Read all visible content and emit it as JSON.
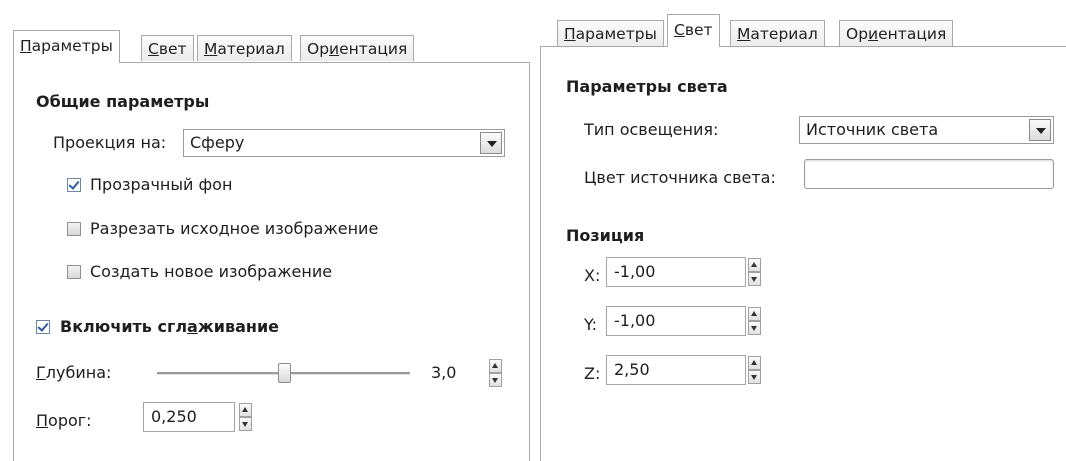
{
  "left": {
    "tabs": [
      {
        "pre": "",
        "acc": "П",
        "post": "араметры",
        "active": true
      },
      {
        "pre": "",
        "acc": "С",
        "post": "вет",
        "active": false
      },
      {
        "pre": "",
        "acc": "М",
        "post": "атериал",
        "active": false
      },
      {
        "pre": "Ор",
        "acc": "и",
        "post": "ентация",
        "active": false
      }
    ],
    "general_title": "Общие параметры",
    "projection_label": "Проекция на:",
    "projection_value": "Сферу",
    "transparent_label": "Прозрачный фон",
    "transparent_checked": true,
    "cut_label": "Разрезать исходное изображение",
    "cut_checked": false,
    "new_image_label": "Создать новое изображение",
    "new_image_checked": false,
    "antialias_pre": "Включить сгл",
    "antialias_acc": "а",
    "antialias_post": "живание",
    "antialias_checked": true,
    "depth_acc": "Г",
    "depth_post": "лубина:",
    "depth_value": "3,0",
    "depth_fraction": 0.5,
    "threshold_acc": "П",
    "threshold_post": "орог:",
    "threshold_value": "0,250"
  },
  "right": {
    "tabs": [
      {
        "pre": "",
        "acc": "П",
        "post": "араметры",
        "active": false
      },
      {
        "pre": "",
        "acc": "С",
        "post": "вет",
        "active": true
      },
      {
        "pre": "",
        "acc": "М",
        "post": "атериал",
        "active": false
      },
      {
        "pre": "Ор",
        "acc": "и",
        "post": "ентация",
        "active": false
      }
    ],
    "light_title": "Параметры света",
    "light_type_label": "Тип освещения:",
    "light_type_value": "Источник света",
    "light_color_label": "Цвет источника света:",
    "light_color_value": "#ffffff",
    "position_title": "Позиция",
    "x_label": "X:",
    "x_value": "-1,00",
    "y_label": "Y:",
    "y_value": "-1,00",
    "z_label": "Z:",
    "z_value": "2,50"
  }
}
